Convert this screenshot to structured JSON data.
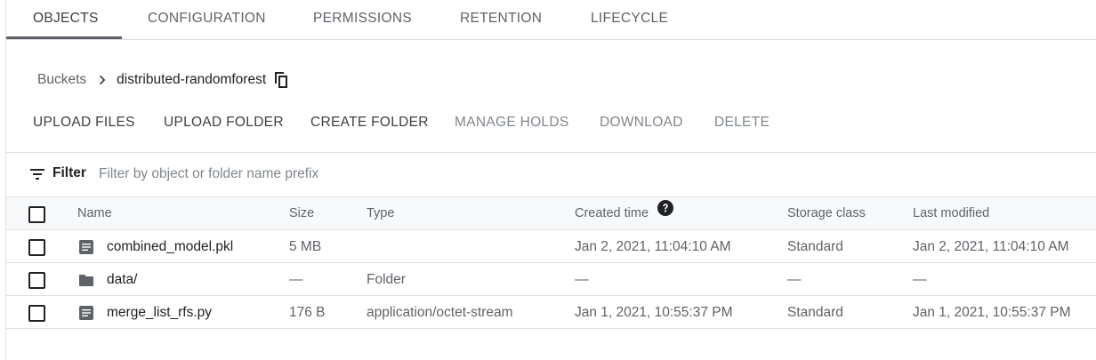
{
  "tabs": [
    {
      "label": "OBJECTS",
      "active": true
    },
    {
      "label": "CONFIGURATION",
      "active": false
    },
    {
      "label": "PERMISSIONS",
      "active": false
    },
    {
      "label": "RETENTION",
      "active": false
    },
    {
      "label": "LIFECYCLE",
      "active": false
    }
  ],
  "breadcrumb": {
    "root": "Buckets",
    "separator_icon": "chevron-right-icon",
    "current": "distributed-randomforest",
    "copy_icon": "copy-icon"
  },
  "actions": [
    {
      "label": "UPLOAD FILES",
      "enabled": true
    },
    {
      "label": "UPLOAD FOLDER",
      "enabled": true
    },
    {
      "label": "CREATE FOLDER",
      "enabled": true
    },
    {
      "label": "MANAGE HOLDS",
      "enabled": false
    },
    {
      "label": "DOWNLOAD",
      "enabled": false
    },
    {
      "label": "DELETE",
      "enabled": false
    }
  ],
  "filter": {
    "icon": "filter-list-icon",
    "label": "Filter",
    "placeholder": "Filter by object or folder name prefix",
    "value": ""
  },
  "table": {
    "columns": {
      "name": "Name",
      "size": "Size",
      "type": "Type",
      "created": "Created time",
      "storage_class": "Storage class",
      "last_modified": "Last modified"
    },
    "created_help_icon": "help-icon",
    "rows": [
      {
        "icon": "file-icon",
        "name": "combined_model.pkl",
        "size": "5 MB",
        "type": "",
        "created": "Jan 2, 2021, 11:04:10 AM",
        "storage_class": "Standard",
        "last_modified": "Jan 2, 2021, 11:04:10 AM"
      },
      {
        "icon": "folder-icon",
        "name": "data/",
        "size": "—",
        "type": "Folder",
        "created": "—",
        "storage_class": "—",
        "last_modified": "—"
      },
      {
        "icon": "file-icon",
        "name": "merge_list_rfs.py",
        "size": "176 B",
        "type": "application/octet-stream",
        "created": "Jan 1, 2021, 10:55:37 PM",
        "storage_class": "Standard",
        "last_modified": "Jan 1, 2021, 10:55:37 PM"
      }
    ]
  },
  "colors": {
    "text_primary": "#202124",
    "text_secondary": "#5f6368",
    "disabled": "#80868b",
    "divider": "#e0e0e0",
    "header_bg": "#f8f9fa"
  }
}
